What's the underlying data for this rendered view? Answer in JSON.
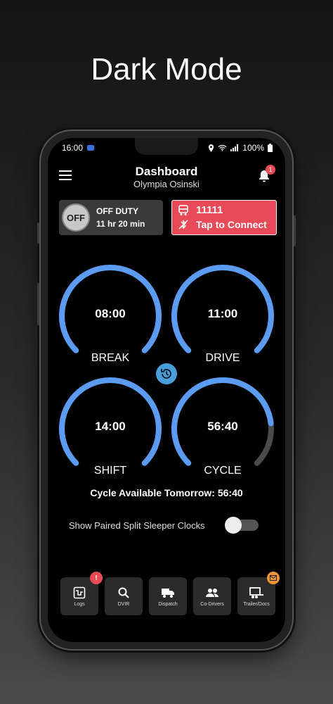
{
  "hero": {
    "title": "Dark Mode"
  },
  "status_bar": {
    "time": "16:00",
    "battery": "100%"
  },
  "header": {
    "title": "Dashboard",
    "subtitle": "Olympia Osinski",
    "notification_count": "1"
  },
  "duty": {
    "badge": "OFF",
    "status": "OFF DUTY",
    "duration": "11 hr 20 min"
  },
  "connection": {
    "vehicle_id": "11111",
    "action": "Tap to Connect",
    "color": "#e84a57"
  },
  "gauges": [
    {
      "value": "08:00",
      "label": "BREAK",
      "fraction": 1.0
    },
    {
      "value": "11:00",
      "label": "DRIVE",
      "fraction": 1.0
    },
    {
      "value": "14:00",
      "label": "SHIFT",
      "fraction": 1.0
    },
    {
      "value": "56:40",
      "label": "CYCLE",
      "fraction": 0.81
    }
  ],
  "colors": {
    "accent": "#5b9cf2",
    "track": "#4a4a4a"
  },
  "cycle_message": "Cycle Available Tomorrow: 56:40",
  "toggle": {
    "label": "Show Paired Split Sleeper Clocks",
    "on": false
  },
  "nav": [
    {
      "label": "Logs",
      "icon": "logs-icon",
      "badge": "!"
    },
    {
      "label": "DVIR",
      "icon": "search-icon"
    },
    {
      "label": "Dispatch",
      "icon": "truck-icon"
    },
    {
      "label": "Co-Drivers",
      "icon": "people-icon"
    },
    {
      "label": "Trailer/Docs",
      "icon": "trailer-icon",
      "badge": "mail"
    }
  ]
}
